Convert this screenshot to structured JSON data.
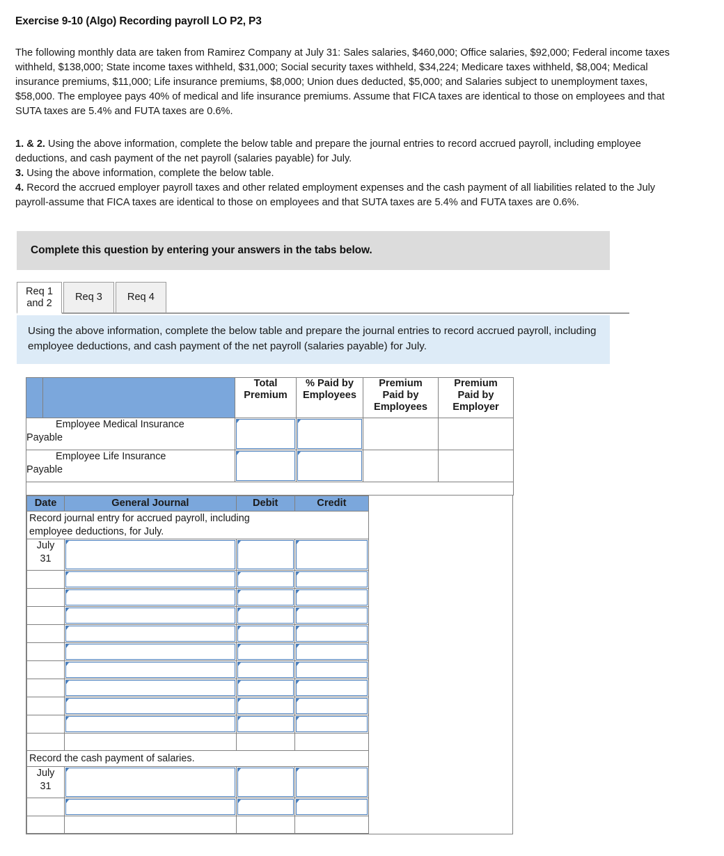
{
  "exercise": {
    "title": "Exercise 9-10 (Algo) Recording payroll LO P2, P3",
    "intro": "The following monthly data are taken from Ramirez Company at July 31: Sales salaries, $460,000; Office salaries, $92,000; Federal income taxes withheld, $138,000; State income taxes withheld, $31,000; Social security taxes withheld, $34,224; Medicare taxes withheld, $8,004; Medical insurance premiums, $11,000; Life insurance premiums, $8,000; Union dues deducted, $5,000; and Salaries subject to unemployment taxes, $58,000. The employee pays 40% of medical and life insurance premiums. Assume that FICA taxes are identical to those on employees and that SUTA taxes are 5.4% and FUTA taxes are 0.6%."
  },
  "requirements": {
    "item1_label": "1. & 2.",
    "item1_text": " Using the above information, complete the below table and prepare the journal entries to record accrued payroll, including employee deductions, and cash payment of the net payroll (salaries payable) for July.",
    "item3_label": "3.",
    "item3_text": " Using the above information, complete the below table.",
    "item4_label": "4.",
    "item4_text": " Record the accrued employer payroll taxes and other related employment expenses and the cash payment of all liabilities related to the July payroll-assume that FICA taxes are identical to those on employees and that SUTA taxes are 5.4% and FUTA taxes are 0.6%."
  },
  "banner": {
    "text": "Complete this question by entering your answers in the tabs below."
  },
  "tabs": [
    {
      "label_line1": "Req 1",
      "label_line2": "and 2",
      "active": true
    },
    {
      "label_line1": "Req 3",
      "label_line2": "",
      "active": false
    },
    {
      "label_line1": "Req 4",
      "label_line2": "",
      "active": false
    }
  ],
  "instruction_panel": {
    "text": "Using the above information, complete the below table and prepare the journal entries to record accrued payroll, including employee deductions, and cash payment of the net payroll (salaries payable) for July."
  },
  "premium_table": {
    "headers": [
      "",
      "",
      "Total Premium",
      "% Paid by Employees",
      "Premium Paid by Employees",
      "Premium Paid by Employer"
    ],
    "header_lines": [
      [
        "",
        ""
      ],
      [
        "",
        ""
      ],
      [
        "Total",
        "Premium"
      ],
      [
        "% Paid by",
        "Employees"
      ],
      [
        "Premium",
        "Paid by",
        "Employees"
      ],
      [
        "Premium",
        "Paid by",
        "Employer"
      ]
    ],
    "rows": [
      {
        "label_line1": "Employee Medical Insurance",
        "label_line2": "Payable",
        "total_premium": "",
        "pct_paid_by_employees": "",
        "premium_paid_by_employees": "",
        "premium_paid_by_employer": ""
      },
      {
        "label_line1": "Employee Life Insurance",
        "label_line2": "Payable",
        "total_premium": "",
        "pct_paid_by_employees": "",
        "premium_paid_by_employees": "",
        "premium_paid_by_employer": ""
      }
    ]
  },
  "journal_table": {
    "headers": [
      "Date",
      "General Journal",
      "Debit",
      "Credit"
    ],
    "section1": {
      "note_line1": "Record journal entry for accrued payroll, including",
      "note_line2": "employee deductions, for July.",
      "entries": [
        {
          "date_line1": "July",
          "date_line2": "31",
          "account": "",
          "debit": "",
          "credit": "",
          "input": true,
          "tall": true
        },
        {
          "date_line1": "",
          "date_line2": "",
          "account": "",
          "debit": "",
          "credit": "",
          "input": true,
          "tall": false
        },
        {
          "date_line1": "",
          "date_line2": "",
          "account": "",
          "debit": "",
          "credit": "",
          "input": true,
          "tall": false
        },
        {
          "date_line1": "",
          "date_line2": "",
          "account": "",
          "debit": "",
          "credit": "",
          "input": true,
          "tall": false
        },
        {
          "date_line1": "",
          "date_line2": "",
          "account": "",
          "debit": "",
          "credit": "",
          "input": true,
          "tall": false
        },
        {
          "date_line1": "",
          "date_line2": "",
          "account": "",
          "debit": "",
          "credit": "",
          "input": true,
          "tall": false
        },
        {
          "date_line1": "",
          "date_line2": "",
          "account": "",
          "debit": "",
          "credit": "",
          "input": true,
          "tall": false
        },
        {
          "date_line1": "",
          "date_line2": "",
          "account": "",
          "debit": "",
          "credit": "",
          "input": true,
          "tall": false
        },
        {
          "date_line1": "",
          "date_line2": "",
          "account": "",
          "debit": "",
          "credit": "",
          "input": true,
          "tall": false
        },
        {
          "date_line1": "",
          "date_line2": "",
          "account": "",
          "debit": "",
          "credit": "",
          "input": true,
          "tall": false
        },
        {
          "date_line1": "",
          "date_line2": "",
          "account": "",
          "debit": "",
          "credit": "",
          "input": false,
          "tall": false
        }
      ]
    },
    "section2": {
      "note_line1": "Record the cash payment of salaries.",
      "note_line2": "",
      "entries": [
        {
          "date_line1": "July",
          "date_line2": "31",
          "account": "",
          "debit": "",
          "credit": "",
          "input": true,
          "tall": true
        },
        {
          "date_line1": "",
          "date_line2": "",
          "account": "",
          "debit": "",
          "credit": "",
          "input": true,
          "tall": false
        },
        {
          "date_line1": "",
          "date_line2": "",
          "account": "",
          "debit": "",
          "credit": "",
          "input": false,
          "tall": false
        }
      ]
    }
  },
  "colors": {
    "header_blue": "#7ba7dc",
    "panel_blue": "#ddebf7",
    "banner_gray": "#dcdcdc",
    "input_border": "#4a7ebb",
    "grid_border": "#808080"
  }
}
